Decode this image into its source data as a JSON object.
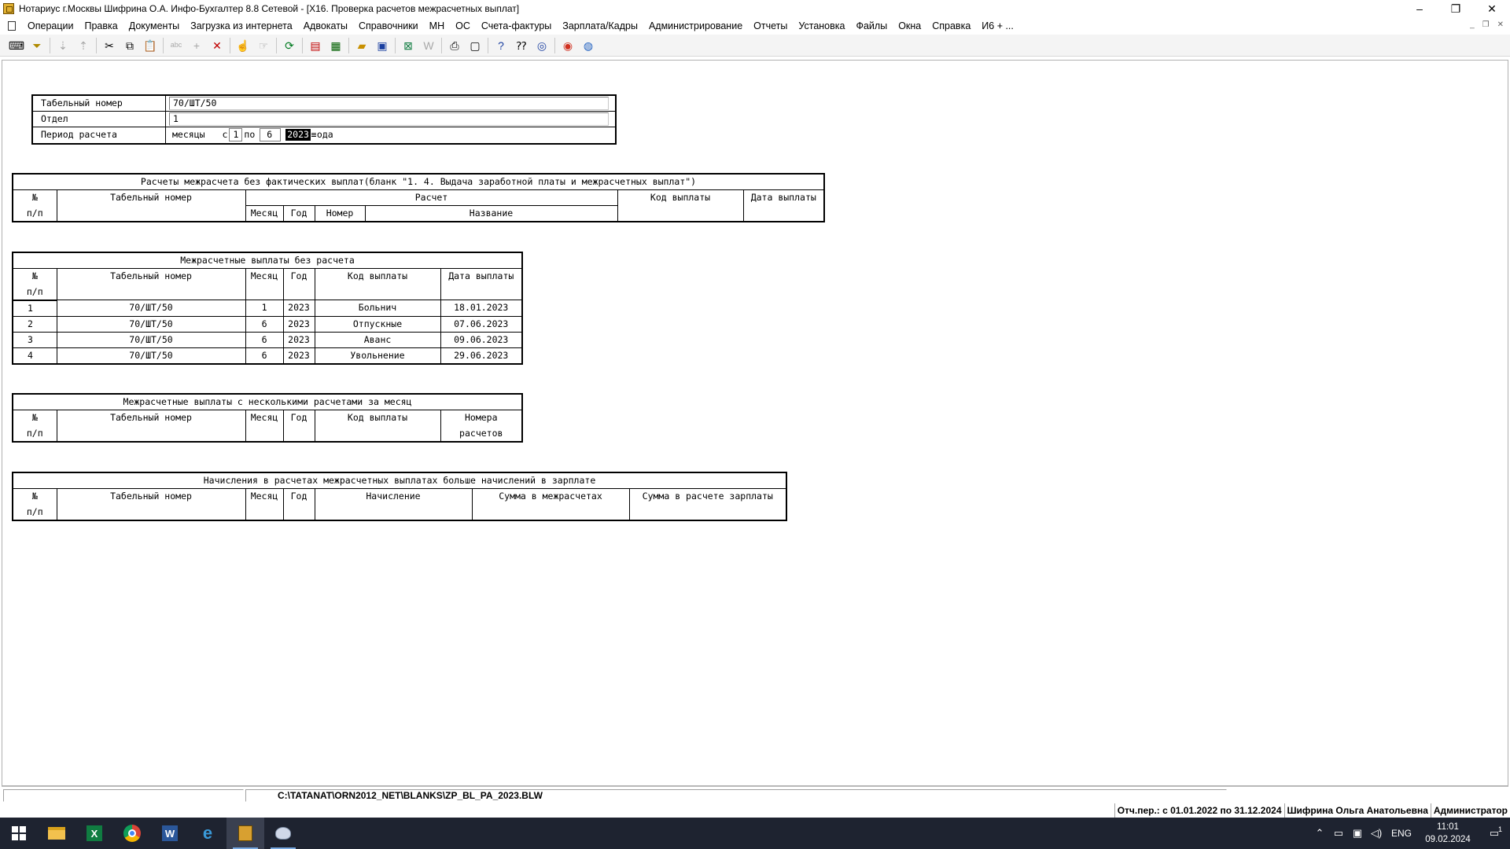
{
  "window": {
    "title": "Нотариус г.Москвы Шифрина О.А. Инфо-Бухгалтер 8.8 Сетевой - [X16. Проверка расчетов межрасчетных выплат]",
    "controls": {
      "minimize": "–",
      "restore": "❐",
      "close": "✕"
    }
  },
  "menu": [
    "Операции",
    "Правка",
    "Документы",
    "Загрузка из интернета",
    "Адвокаты",
    "Справочники",
    "МН",
    "ОС",
    "Счета-фактуры",
    "Зарплата/Кадры",
    "Администрирование",
    "Отчеты",
    "Установка",
    "Файлы",
    "Окна",
    "Справка",
    "И6 + ..."
  ],
  "form": {
    "tab_label": "Табельный номер",
    "tab_value": "70/ШТ/50",
    "dept_label": "Отдел",
    "dept_value": "1",
    "period_label": "Период расчета",
    "period_months": "месяцы",
    "period_from_word": "с",
    "period_from": "1",
    "period_to_word": "по",
    "period_to": "6",
    "period_year": "2023",
    "period_year_suffix": "ода"
  },
  "table1": {
    "caption": "Расчеты межрасчета без фактических выплат(бланк \"1. 4. Выдача заработной платы и межрасчетных выплат\")",
    "h_num_top": "№",
    "h_num_bottom": "п/п",
    "h_tab": "Табельный номер",
    "h_calc": "Расчет",
    "h_month": "Месяц",
    "h_year": "Год",
    "h_number": "Номер",
    "h_name": "Название",
    "h_code": "Код выплаты",
    "h_date": "Дата выплаты"
  },
  "table2": {
    "caption": "Межрасчетные выплаты без расчета",
    "h_num_top": "№",
    "h_num_bottom": "п/п",
    "h_tab": "Табельный номер",
    "h_month": "Месяц",
    "h_year": "Год",
    "h_code": "Код выплаты",
    "h_date": "Дата выплаты",
    "rows": [
      {
        "n": "1",
        "tab": "70/ШТ/50",
        "month": "1",
        "year": "2023",
        "code": "Больнич",
        "date": "18.01.2023"
      },
      {
        "n": "2",
        "tab": "70/ШТ/50",
        "month": "6",
        "year": "2023",
        "code": "Отпускные",
        "date": "07.06.2023"
      },
      {
        "n": "3",
        "tab": "70/ШТ/50",
        "month": "6",
        "year": "2023",
        "code": "Аванс",
        "date": "09.06.2023"
      },
      {
        "n": "4",
        "tab": "70/ШТ/50",
        "month": "6",
        "year": "2023",
        "code": "Увольнение",
        "date": "29.06.2023"
      }
    ]
  },
  "table3": {
    "caption": "Межрасчетные выплаты с несколькими расчетами за месяц",
    "h_num_top": "№",
    "h_num_bottom": "п/п",
    "h_tab": "Табельный номер",
    "h_month": "Месяц",
    "h_year": "Год",
    "h_code": "Код выплаты",
    "h_numbers_top": "Номера",
    "h_numbers_bottom": "расчетов"
  },
  "table4": {
    "caption": "Начисления в расчетах межрасчетных выплатах больше начислений в зарплате",
    "h_num_top": "№",
    "h_num_bottom": "п/п",
    "h_tab": "Табельный номер",
    "h_month": "Месяц",
    "h_year": "Год",
    "h_accrual": "Начисление",
    "h_sum_inter": "Сумма в межрасчетах",
    "h_sum_salary": "Сумма в расчете зарплаты"
  },
  "status": {
    "path": "C:\\TATANAT\\ORN2012_NET\\BLANKS\\ZP_BL_PA_2023.BLW",
    "period": "Отч.пер.: с 01.01.2022 по 31.12.2024",
    "user": "Шифрина Ольга Анатольевна",
    "role": "Администратор"
  },
  "taskbar": {
    "lang": "ENG",
    "time": "11:01",
    "date": "09.02.2024",
    "notifications": "1"
  }
}
